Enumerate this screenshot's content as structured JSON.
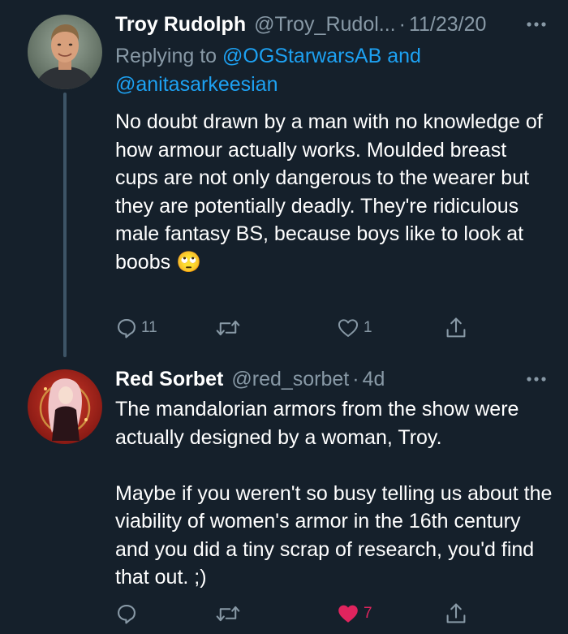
{
  "tweets": [
    {
      "name": "Troy Rudolph",
      "handle": "@Troy_Rudol...",
      "time": "11/23/20",
      "reply_prefix": "Replying to",
      "reply_mention_1": "@OGStarwarsAB",
      "reply_and": "and",
      "reply_mention_2": "@anitasarkeesian",
      "text": "No doubt drawn by a man with no knowledge of how armour actually works. Moulded breast cups are not only dangerous to the wearer but they are potentially deadly.  They're ridiculous male fantasy BS, because boys like to look at boobs",
      "emoji": "🙄",
      "reply_count": "11",
      "retweet_count": "",
      "like_count": "1",
      "liked": false,
      "avatar_icon": "man-portrait-avatar"
    },
    {
      "name": "Red Sorbet",
      "handle": "@red_sorbet",
      "time": "4d",
      "paragraph_1": "The mandalorian armors from the show were actually designed by a woman, Troy.",
      "paragraph_2": "Maybe if you weren't so busy telling us about the viability of women's armor in the 16th century and you did a tiny scrap of research, you'd find that out. ;)",
      "reply_count": "",
      "retweet_count": "",
      "like_count": "7",
      "liked": true,
      "avatar_icon": "anime-character-red-avatar"
    }
  ],
  "colors": {
    "background": "#15202b",
    "text": "#ffffff",
    "muted": "#8899a6",
    "link": "#1da1f2",
    "like": "#e0245e",
    "thread_line": "#3d5466"
  }
}
